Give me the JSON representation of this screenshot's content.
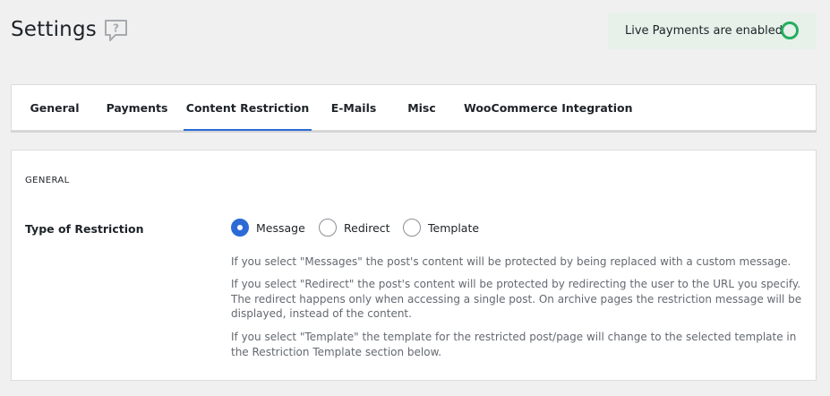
{
  "header": {
    "title": "Settings",
    "live_status": "Live Payments are enabled",
    "live_status_color": "#27ae60"
  },
  "tabs": [
    {
      "label": "General",
      "active": false
    },
    {
      "label": "Payments",
      "active": false
    },
    {
      "label": "Content Restriction",
      "active": true
    },
    {
      "label": "E-Mails",
      "active": false
    },
    {
      "label": "Misc",
      "active": false
    },
    {
      "label": "WooCommerce Integration",
      "active": false
    }
  ],
  "section": {
    "title": "GENERAL",
    "restriction_type": {
      "label": "Type of Restriction",
      "options": [
        {
          "label": "Message",
          "checked": true
        },
        {
          "label": "Redirect",
          "checked": false
        },
        {
          "label": "Template",
          "checked": false
        }
      ],
      "selected": "Message",
      "descriptions": [
        "If you select \"Messages\" the post's content will be protected by being replaced with a custom message.",
        "If you select \"Redirect\" the post's content will be protected by redirecting the user to the URL you specify. The redirect happens only when accessing a single post. On archive pages the restriction message will be displayed, instead of the content.",
        "If you select \"Template\" the template for the restricted post/page will change to the selected template in the Restriction Template section below."
      ]
    }
  },
  "colors": {
    "accent": "#2c6bd6",
    "page_bg": "#f0f0f1",
    "status_bg": "#e7f1ea"
  }
}
